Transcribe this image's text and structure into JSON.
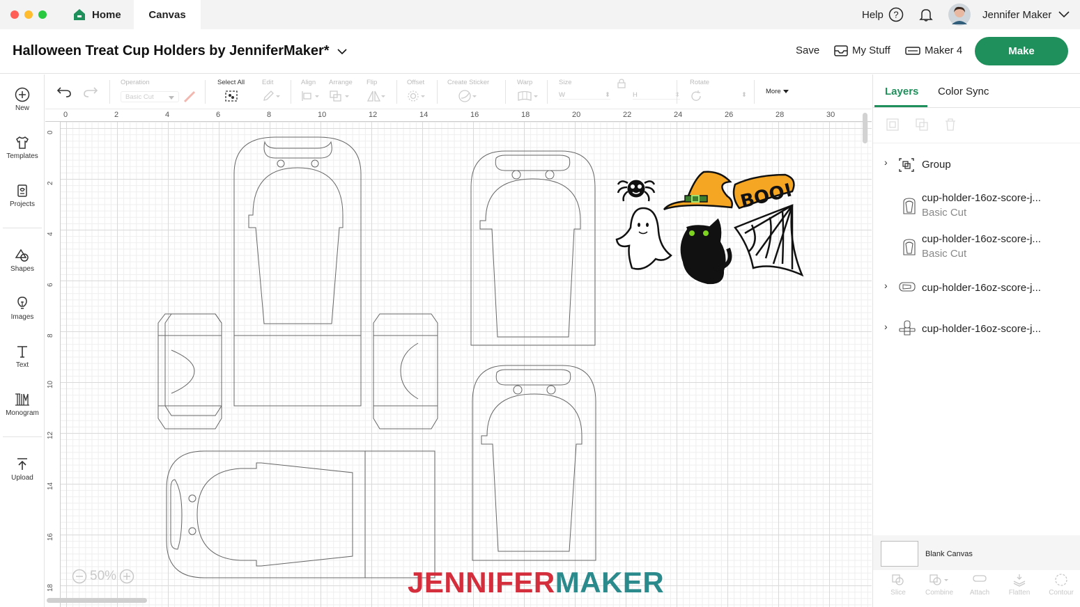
{
  "window": {
    "traffic_colors": [
      "#ff5f57",
      "#febc2e",
      "#28c840"
    ]
  },
  "tabs": {
    "home": "Home",
    "canvas": "Canvas"
  },
  "topright": {
    "help": "Help",
    "user_name": "Jennifer Maker"
  },
  "header": {
    "project_title": "Halloween Treat Cup Holders by JenniferMaker*",
    "save": "Save",
    "my_stuff": "My Stuff",
    "machine": "Maker 4",
    "make": "Make",
    "accent_color": "#1f8f5b"
  },
  "sidebar": {
    "items": [
      {
        "label": "New",
        "icon": "plus-circle-icon"
      },
      {
        "label": "Templates",
        "icon": "shirt-icon"
      },
      {
        "label": "Projects",
        "icon": "projects-icon"
      },
      {
        "label": "Shapes",
        "icon": "shapes-icon"
      },
      {
        "label": "Images",
        "icon": "lightbulb-icon"
      },
      {
        "label": "Text",
        "icon": "text-icon"
      },
      {
        "label": "Monogram",
        "icon": "monogram-icon"
      },
      {
        "label": "Upload",
        "icon": "upload-icon"
      }
    ]
  },
  "toolbar": {
    "operation_label": "Operation",
    "operation_value": "Basic Cut",
    "select_all": "Select All",
    "edit": "Edit",
    "align": "Align",
    "arrange": "Arrange",
    "flip": "Flip",
    "offset": "Offset",
    "create_sticker": "Create Sticker",
    "warp": "Warp",
    "size": "Size",
    "size_w": "W",
    "size_h": "H",
    "rotate": "Rotate",
    "more": "More"
  },
  "canvas": {
    "ruler_top": [
      "0",
      "2",
      "4",
      "6",
      "8",
      "10",
      "12",
      "14",
      "16",
      "18",
      "20",
      "22",
      "24",
      "26",
      "28",
      "30"
    ],
    "ruler_left": [
      "0",
      "2",
      "4",
      "6",
      "8",
      "10",
      "12",
      "14",
      "16",
      "18"
    ],
    "zoom": "50%",
    "watermark_part1": "JENNIFER",
    "watermark_part2": "MAKER",
    "watermark_color1": "#d42d3c",
    "watermark_color2": "#2a8a8c"
  },
  "right_panel": {
    "tab_layers": "Layers",
    "tab_color_sync": "Color Sync",
    "layers": [
      {
        "name": "Group",
        "sub": "",
        "expandable": true,
        "icon": "group-icon"
      },
      {
        "name": "cup-holder-16oz-score-j...",
        "sub": "Basic Cut",
        "expandable": false,
        "icon": "cup-shape-icon"
      },
      {
        "name": "cup-holder-16oz-score-j...",
        "sub": "Basic Cut",
        "expandable": false,
        "icon": "cup-shape-icon"
      },
      {
        "name": "cup-holder-16oz-score-j...",
        "sub": "",
        "expandable": true,
        "icon": "cup-side-icon"
      },
      {
        "name": "cup-holder-16oz-score-j...",
        "sub": "",
        "expandable": true,
        "icon": "cup-group-icon"
      }
    ],
    "blank_canvas": "Blank Canvas",
    "bottom_actions": [
      "Slice",
      "Combine",
      "Attach",
      "Flatten",
      "Contour"
    ]
  }
}
